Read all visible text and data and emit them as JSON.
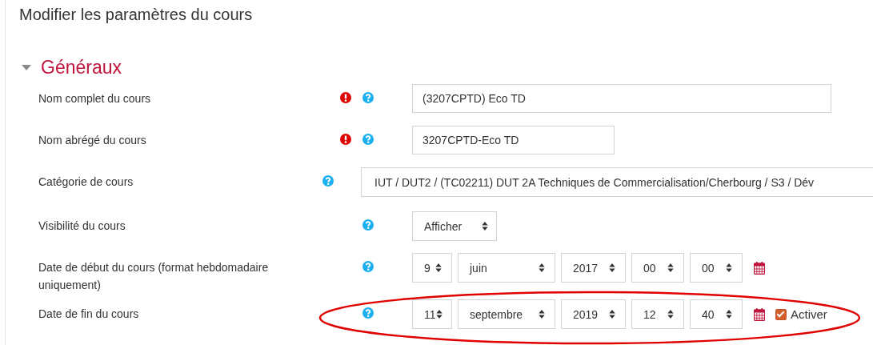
{
  "page_title": "Modifier les paramètres du cours",
  "section": {
    "title": "Généraux",
    "expanded": true
  },
  "fields": [
    {
      "label": "Nom complet du cours",
      "required": true,
      "kind": "text",
      "value": "(3207CPTD) Eco TD"
    },
    {
      "label": "Nom abrégé du cours",
      "required": true,
      "kind": "text",
      "value": "3207CPTD-Eco TD"
    },
    {
      "label": "Catégorie de cours",
      "required": false,
      "kind": "select",
      "value": "IUT / DUT2 / (TC02211) DUT 2A Techniques de Commercialisation/Cherbourg / S3 / Dév"
    },
    {
      "label": "Visibilité du cours",
      "required": false,
      "kind": "select",
      "value": "Afficher"
    },
    {
      "label": "Date de début du cours (format hebdomadaire uniquement)",
      "required": false,
      "kind": "date",
      "highlighted": false,
      "parts": [
        "9",
        "juin",
        "2017",
        "00",
        "00"
      ]
    },
    {
      "label": "Date de fin du cours",
      "required": false,
      "kind": "date",
      "highlighted": true,
      "parts": [
        "11",
        "septembre",
        "2019",
        "12",
        "40"
      ],
      "enable": {
        "label": "Activer",
        "checked": true
      }
    }
  ]
}
